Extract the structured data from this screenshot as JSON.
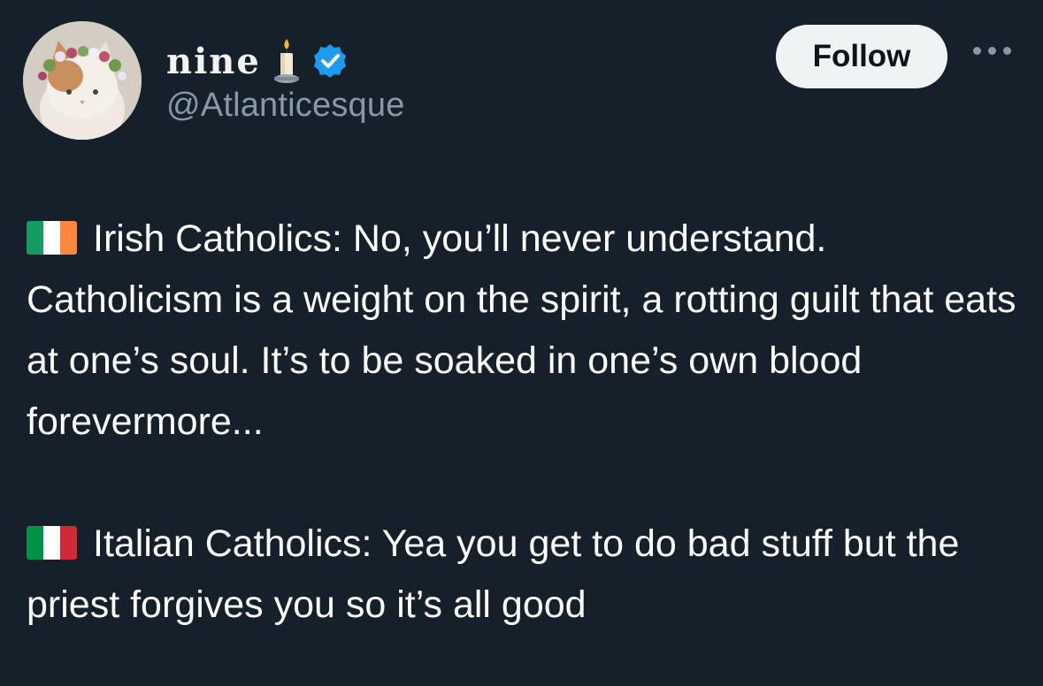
{
  "user": {
    "display_name": "nine",
    "handle": "@Atlanticesque",
    "name_emoji_icon": "candle-icon",
    "verified_icon": "verified-badge-icon",
    "avatar_icon": "avatar"
  },
  "actions": {
    "follow_label": "Follow",
    "more_icon": "more-options-icon"
  },
  "tweet": {
    "paragraphs": [
      {
        "flag_icon": "ireland-flag-icon",
        "text": "Irish Catholics: No, you’ll never understand. Catholicism is a weight on the spirit, a rotting guilt that eats at one’s soul. It’s to be soaked in one’s own blood forevermore..."
      },
      {
        "flag_icon": "italy-flag-icon",
        "text": "Italian Catholics: Yea you get to do bad stuff but the priest forgives you so it’s all good"
      }
    ]
  },
  "colors": {
    "background": "#15202b",
    "text_primary": "#ffffff",
    "text_secondary": "#8899a6",
    "follow_bg": "#eff3f4",
    "verified_blue": "#1d9bf0"
  }
}
